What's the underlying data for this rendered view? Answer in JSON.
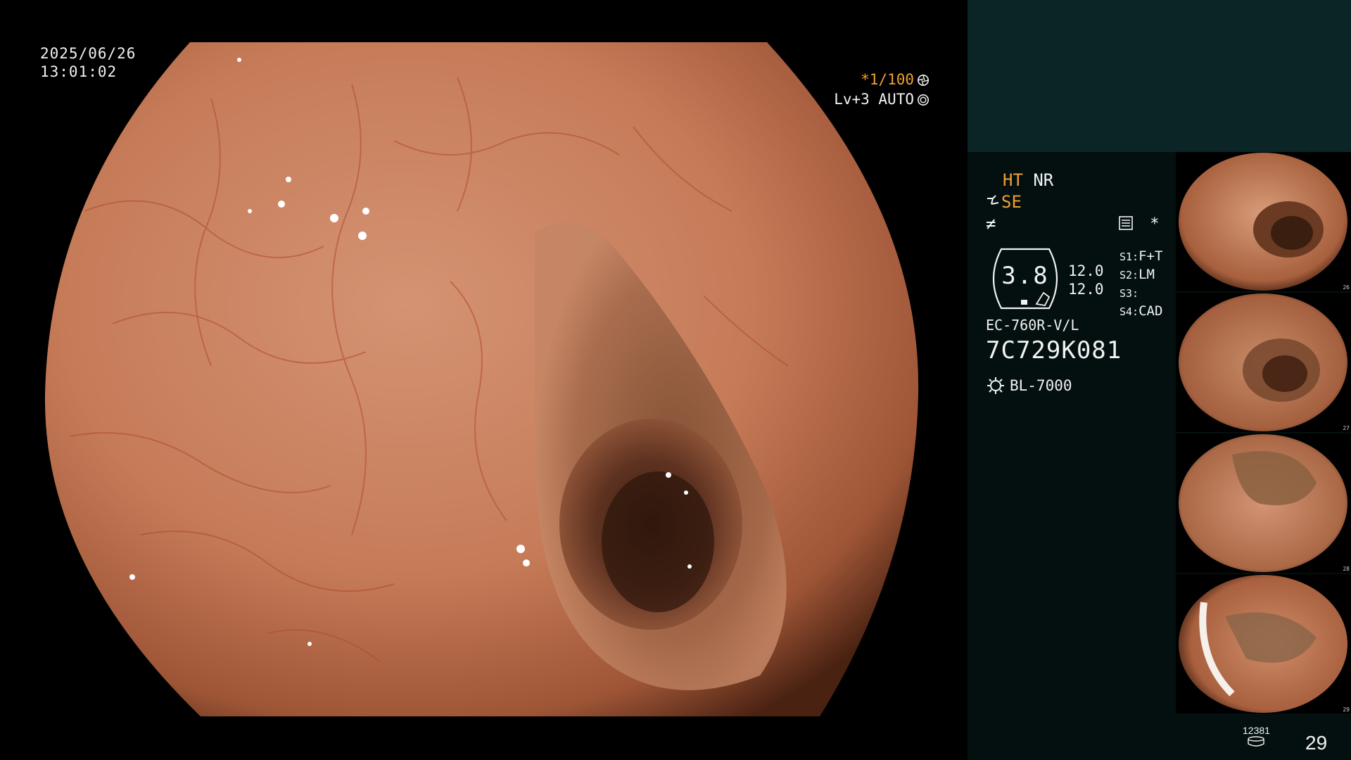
{
  "datetime": {
    "date": "2025/06/26",
    "time": "13:01:02"
  },
  "shutter": {
    "value": "*1/100",
    "level": "Lv+3 AUTO"
  },
  "modes": {
    "ht": "HT",
    "nr": "NR",
    "se": "SE",
    "f": "≠"
  },
  "settings_star": "*",
  "gauge": {
    "value": "3.8"
  },
  "levels": [
    "12.0",
    "12.0"
  ],
  "scope_settings": [
    {
      "key": "S1:",
      "value": "F+T"
    },
    {
      "key": "S2:",
      "value": "LM"
    },
    {
      "key": "S3:",
      "value": ""
    },
    {
      "key": "S4:",
      "value": "CAD"
    }
  ],
  "scope": {
    "model": "EC-760R-V/L",
    "serial": "7C729K081"
  },
  "light_source": "BL-7000",
  "thumbnails": [
    {
      "number": "26"
    },
    {
      "number": "27"
    },
    {
      "number": "28"
    },
    {
      "number": "29"
    }
  ],
  "counters": {
    "storage": "12381",
    "image_count": "29"
  },
  "colors": {
    "accent_orange": "#f0a030",
    "panel_bg": "#041010",
    "panel_top": "#0b2426"
  }
}
